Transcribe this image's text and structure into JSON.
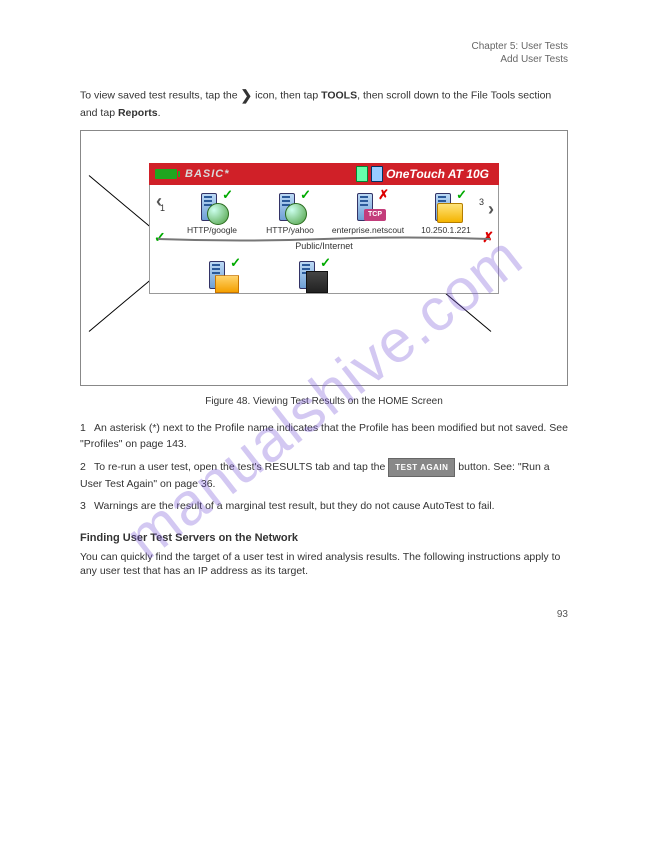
{
  "header": {
    "line1": "Chapter 5: User Tests",
    "line2": "Add User Tests"
  },
  "section_title_pre": "To view saved test results, tap the ",
  "section_title_icon": "❯",
  "section_title_post": " icon, then tap ",
  "section_title_tools": "TOOLS",
  "section_title_mid": ", then scroll down to the File Tools section and tap ",
  "section_title_reports": "Reports",
  "device": {
    "profile": "BASIC*",
    "product": "OneTouch AT 10G",
    "row_label": "Public/Internet",
    "left_num": "1",
    "right_num": "3",
    "icons": [
      {
        "label": "HTTP/google",
        "status": "pass"
      },
      {
        "label": "HTTP/yahoo",
        "status": "pass"
      },
      {
        "label": "enterprise.netscout",
        "status": "fail"
      },
      {
        "label": "10.250.1.221",
        "status": "pass"
      }
    ],
    "tcp_badge": "TCP"
  },
  "figure_caption": "Figure 48. Viewing Test Results on the HOME Screen",
  "callouts": {
    "c1_num": "1",
    "c1_text": "An asterisk (*) next to the Profile name indicates that the Profile has been modified but not saved. See \"Profiles\" on page 143.",
    "c2_num": "2",
    "c2_text_a": "To re-run a user test, open the test's RESULTS tab and tap the ",
    "c2_text_b": " button. See: \"Run a User Test Again\" on page 36.",
    "c3_num": "3",
    "c3_text": "Warnings are the result of a marginal test result, but they do not cause AutoTest to fail."
  },
  "test_again": "TEST AGAIN",
  "subhead": "Finding User Test Servers on the Network",
  "sub_body": "You can quickly find the target of a user test in wired analysis results. The following instructions apply to any user test that has an IP address as its target.",
  "page_num": "93",
  "watermark": "manualshive.com"
}
